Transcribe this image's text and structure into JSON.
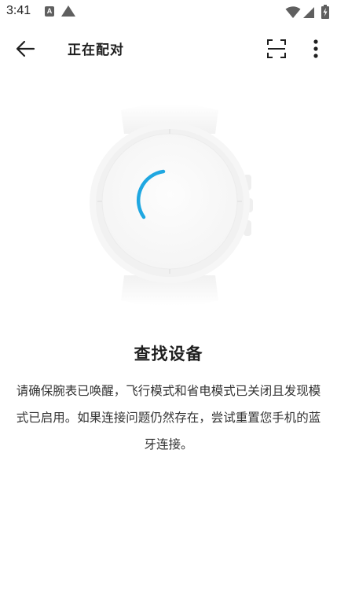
{
  "status_bar": {
    "time": "3:41",
    "notification_letter": "A",
    "icons": [
      "a-notification-icon",
      "triangle-notification-icon",
      "wifi-icon",
      "cellular-signal-icon",
      "battery-charging-icon"
    ]
  },
  "app_bar": {
    "title": "正在配对",
    "icons": [
      "back-arrow-icon",
      "scan-icon",
      "more-vert-icon"
    ]
  },
  "pairing": {
    "illustration": "watch-icon",
    "spinner": "loading-spinner-icon",
    "title": "查找设备",
    "description": "请确保腕表已唤醒，飞行模式和省电模式已关闭且发现模式已启用。如果连接问题仍然存在，尝试重置您手机的蓝牙连接。"
  },
  "colors": {
    "accent": "#1fa7e1",
    "text_primary": "#1f1f1f",
    "text_secondary": "#333333",
    "background": "#ffffff"
  }
}
